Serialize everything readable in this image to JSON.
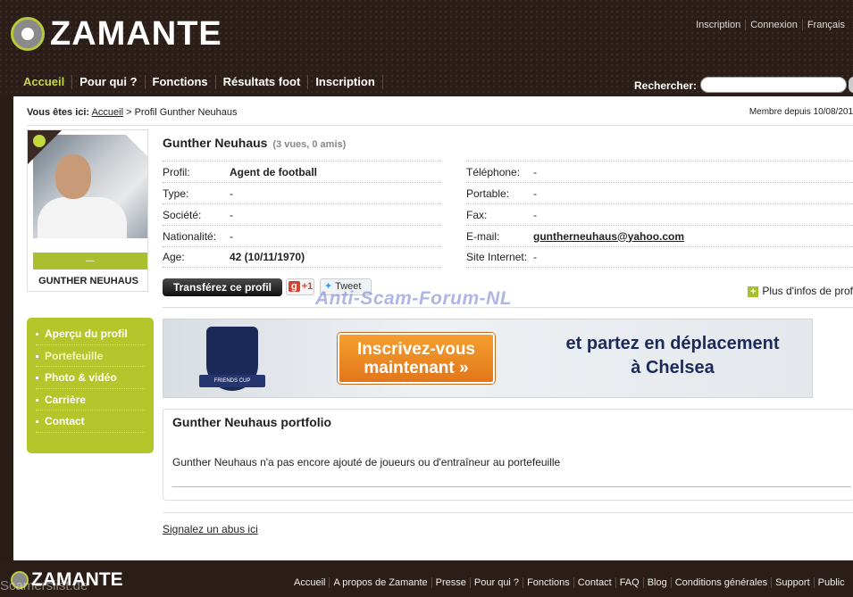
{
  "brand": {
    "name": "ZAMANTE"
  },
  "toplinks": [
    "Inscription",
    "Connexion",
    "Français"
  ],
  "nav": [
    {
      "label": "Accueil",
      "active": true
    },
    {
      "label": "Pour qui ?"
    },
    {
      "label": "Fonctions"
    },
    {
      "label": "Résultats foot"
    },
    {
      "label": "Inscription"
    }
  ],
  "search": {
    "label": "Rechercher:",
    "placeholder": ""
  },
  "breadcrumb": {
    "prefix": "Vous êtes ici:",
    "home": "Accueil",
    "current": "> Profil Gunther Neuhaus"
  },
  "member_since": "Membre depuis 10/08/201",
  "card": {
    "bar_text": "—",
    "name": "GUNTHER NEUHAUS"
  },
  "profile": {
    "name": "Gunther Neuhaus",
    "stats": "(3 vues, 0 amis)",
    "left": [
      {
        "key": "Profil:",
        "value": "Agent de football",
        "bold": true
      },
      {
        "key": "Type:",
        "value": "-"
      },
      {
        "key": "Société:",
        "value": "-"
      },
      {
        "key": "Nationalité:",
        "value": "-"
      },
      {
        "key": "Age:",
        "value": "42 (10/11/1970)",
        "bold": true
      }
    ],
    "right": [
      {
        "key": "Téléphone:",
        "value": "-"
      },
      {
        "key": "Portable:",
        "value": "-"
      },
      {
        "key": "Fax:",
        "value": "-"
      },
      {
        "key": "E-mail:",
        "value": "guntherneuhaus@yahoo.com",
        "link": true
      },
      {
        "key": "Site Internet:",
        "value": "-"
      }
    ]
  },
  "actions": {
    "transfer": "Transférez ce profil",
    "gplus": "+1",
    "tweet": "Tweet",
    "more_info": "Plus d'infos de prof"
  },
  "watermark": "Anti-Scam-Forum-NL",
  "sidemenu": [
    {
      "label": "Aperçu du profil"
    },
    {
      "label": "Portefeuille",
      "active": true
    },
    {
      "label": "Photo & vidéo"
    },
    {
      "label": "Carrière"
    },
    {
      "label": "Contact"
    }
  ],
  "banner": {
    "cta_line1": "Inscrivez-vous",
    "cta_line2": "maintenant »",
    "tag_line1": "et partez en déplacement",
    "tag_line2": "à Chelsea",
    "crest_text": "FRIENDS CUP"
  },
  "portfolio": {
    "title": "Gunther Neuhaus portfolio",
    "text": "Gunther Neuhaus n'a pas encore ajouté de joueurs ou d'entraîneur au portefeuille"
  },
  "abuse_link": "Signalez un abus ici",
  "footer": {
    "watermark": "Scamerslist.de",
    "links": [
      "Accueil",
      "A propos de Zamante",
      "Presse",
      "Pour qui ?",
      "Fonctions",
      "Contact",
      "FAQ",
      "Blog",
      "Conditions générales",
      "Support",
      "Public"
    ]
  }
}
